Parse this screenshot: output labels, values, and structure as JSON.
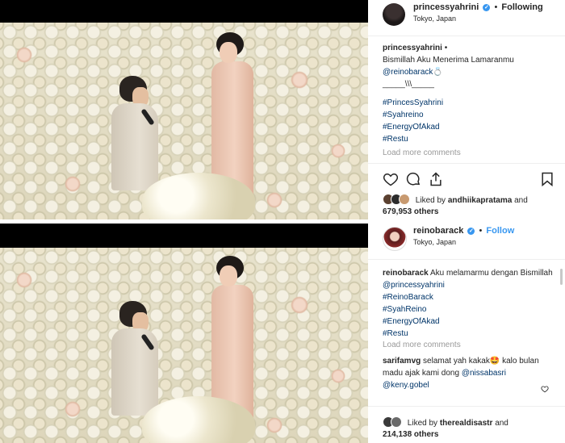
{
  "post1": {
    "username": "princessyahrini",
    "follow_label": "Following",
    "location": "Tokyo, Japan",
    "caption_user": "princessyahrini",
    "caption_lines": [
      "Bismillah Aku Menerima Lamaranmu",
      "@reinobarack💍",
      "_____\\\\\\_____"
    ],
    "hashtags": [
      "#PrincesSyahrini",
      "#Syahreino",
      "#EnergyOfAkad",
      "#Restu"
    ],
    "load_more": "Load more comments",
    "liked_by_user": "andhiikapratama",
    "liked_prefix": "Liked by",
    "liked_suffix": "and",
    "liked_count": "679,953 others"
  },
  "post2": {
    "username": "reinobarack",
    "follow_label": "Follow",
    "location": "Tokyo, Japan",
    "caption_user": "reinobarack",
    "caption_text": "Aku melamarmu dengan Bismillah",
    "caption_mention": "@princessyahrini",
    "hashtags": [
      "#ReinoBarack",
      "#SyahReino",
      "#EnergyOfAkad",
      "#Restu"
    ],
    "load_more": "Load more comments",
    "comment_user": "sarifamvg",
    "comment_text_1": "selamat yah kakak🤩 kalo bulan madu ajak kami dong",
    "comment_mention_1": "@nissabasri",
    "comment_mention_2": "@keny.gobel",
    "liked_by_user": "therealdisastr",
    "liked_prefix": "Liked by",
    "liked_suffix": "and",
    "liked_count": "214,138 others"
  },
  "colors": {
    "link": "#003569",
    "follow_blue": "#3897f0",
    "muted": "#999999"
  },
  "icons": [
    "heart-icon",
    "comment-icon",
    "share-icon",
    "bookmark-icon",
    "verified-icon"
  ]
}
